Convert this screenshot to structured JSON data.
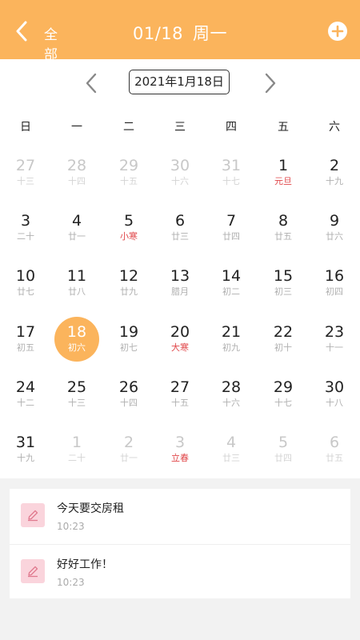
{
  "header": {
    "back_label": "全部",
    "date": "01/18",
    "weekday": "周一",
    "accent": "#fbb45c"
  },
  "calendar": {
    "month_label": "2021年1月18日",
    "weekdays": [
      "日",
      "一",
      "二",
      "三",
      "四",
      "五",
      "六"
    ],
    "days": [
      {
        "n": "27",
        "l": "十三",
        "other": true
      },
      {
        "n": "28",
        "l": "十四",
        "other": true
      },
      {
        "n": "29",
        "l": "十五",
        "other": true
      },
      {
        "n": "30",
        "l": "十六",
        "other": true
      },
      {
        "n": "31",
        "l": "十七",
        "other": true
      },
      {
        "n": "1",
        "l": "元旦",
        "holiday": true
      },
      {
        "n": "2",
        "l": "十九"
      },
      {
        "n": "3",
        "l": "二十"
      },
      {
        "n": "4",
        "l": "廿一"
      },
      {
        "n": "5",
        "l": "小寒",
        "holiday": true
      },
      {
        "n": "6",
        "l": "廿三"
      },
      {
        "n": "7",
        "l": "廿四"
      },
      {
        "n": "8",
        "l": "廿五"
      },
      {
        "n": "9",
        "l": "廿六"
      },
      {
        "n": "10",
        "l": "廿七"
      },
      {
        "n": "11",
        "l": "廿八"
      },
      {
        "n": "12",
        "l": "廿九"
      },
      {
        "n": "13",
        "l": "腊月"
      },
      {
        "n": "14",
        "l": "初二"
      },
      {
        "n": "15",
        "l": "初三"
      },
      {
        "n": "16",
        "l": "初四"
      },
      {
        "n": "17",
        "l": "初五"
      },
      {
        "n": "18",
        "l": "初六",
        "selected": true
      },
      {
        "n": "19",
        "l": "初七"
      },
      {
        "n": "20",
        "l": "大寒",
        "holiday": true
      },
      {
        "n": "21",
        "l": "初九"
      },
      {
        "n": "22",
        "l": "初十"
      },
      {
        "n": "23",
        "l": "十一"
      },
      {
        "n": "24",
        "l": "十二"
      },
      {
        "n": "25",
        "l": "十三"
      },
      {
        "n": "26",
        "l": "十四"
      },
      {
        "n": "27",
        "l": "十五"
      },
      {
        "n": "28",
        "l": "十六"
      },
      {
        "n": "29",
        "l": "十七"
      },
      {
        "n": "30",
        "l": "十八"
      },
      {
        "n": "31",
        "l": "十九"
      },
      {
        "n": "1",
        "l": "二十",
        "other": true
      },
      {
        "n": "2",
        "l": "廿一",
        "other": true
      },
      {
        "n": "3",
        "l": "立春",
        "other": true,
        "holiday": true
      },
      {
        "n": "4",
        "l": "廿三",
        "other": true
      },
      {
        "n": "5",
        "l": "廿四",
        "other": true
      },
      {
        "n": "6",
        "l": "廿五",
        "other": true
      }
    ]
  },
  "notes": [
    {
      "title": "今天要交房租",
      "time": "10:23",
      "icon": "pencil-icon"
    },
    {
      "title": "好好工作！",
      "time": "10:23",
      "icon": "pencil-icon"
    }
  ]
}
